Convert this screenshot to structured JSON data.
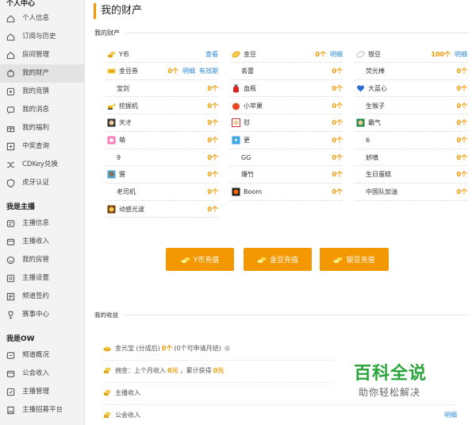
{
  "sidebar": {
    "sections": [
      {
        "title": "个人中心",
        "items": [
          {
            "label": "个人信息",
            "icon": "home-icon"
          },
          {
            "label": "订阅与历史",
            "icon": "home-icon"
          },
          {
            "label": "房间管理",
            "icon": "home-icon"
          },
          {
            "label": "我的财产",
            "icon": "wallet-icon",
            "active": true
          },
          {
            "label": "我的竞猜",
            "icon": "quiz-icon"
          },
          {
            "label": "我的消息",
            "icon": "message-icon"
          },
          {
            "label": "我的福利",
            "icon": "gift-icon"
          },
          {
            "label": "中奖查询",
            "icon": "prize-search-icon"
          },
          {
            "label": "CDKey兑换",
            "icon": "shuffle-icon"
          },
          {
            "label": "虎牙认证",
            "icon": "shield-icon"
          }
        ]
      },
      {
        "title": "我是主播",
        "items": [
          {
            "label": "主播信息",
            "icon": "anchor-info-icon"
          },
          {
            "label": "主播收入",
            "icon": "income-icon"
          },
          {
            "label": "我的房管",
            "icon": "room-admin-icon"
          },
          {
            "label": "主播设置",
            "icon": "settings-icon"
          },
          {
            "label": "频道签约",
            "icon": "contract-icon"
          },
          {
            "label": "赛事中心",
            "icon": "trophy-icon"
          }
        ]
      },
      {
        "title": "我是OW",
        "items": [
          {
            "label": "频道概况",
            "icon": "channel-icon"
          },
          {
            "label": "公会收入",
            "icon": "income-icon"
          },
          {
            "label": "主播管理",
            "icon": "manage-icon"
          },
          {
            "label": "主播招募平台",
            "icon": "recruit-icon"
          }
        ]
      }
    ]
  },
  "main": {
    "title": "我的财产",
    "subtitle": "我的财产",
    "assets_col1": [
      {
        "name": "Y币",
        "icon": "ycoin-icon",
        "link": "查看"
      },
      {
        "name": "金豆券",
        "icon": "coupon-icon",
        "count": "0个",
        "link": "明细",
        "link2": "有效期"
      },
      {
        "name": "宝剑",
        "count": "0个"
      },
      {
        "name": "挖掘机",
        "icon": "excavator-icon",
        "count": "0个"
      },
      {
        "name": "天才",
        "icon": "genius-icon",
        "count": "0个"
      },
      {
        "name": "萌",
        "icon": "cute-icon",
        "count": "0个"
      },
      {
        "name": "9",
        "count": "0个"
      },
      {
        "name": "猩",
        "icon": "gorilla-icon",
        "count": "0个"
      },
      {
        "name": "老司机",
        "count": "0个"
      },
      {
        "name": "动感光波",
        "icon": "wave-icon",
        "count": "0个"
      }
    ],
    "assets_col2": [
      {
        "name": "金豆",
        "icon": "gold-bean-icon",
        "count": "0个",
        "link": "明细"
      },
      {
        "name": "丢雷",
        "count": "0个"
      },
      {
        "name": "血瓶",
        "icon": "blood-bottle-icon",
        "count": "0个"
      },
      {
        "name": "小苹果",
        "icon": "apple-icon",
        "count": "0个"
      },
      {
        "name": "怼",
        "icon": "dui-icon",
        "count": "0个"
      },
      {
        "name": "更",
        "icon": "geng-icon",
        "count": "0个"
      },
      {
        "name": "GG",
        "count": "0个"
      },
      {
        "name": "爆竹",
        "count": "0个"
      },
      {
        "name": "Boom",
        "icon": "boom-icon",
        "count": "0个"
      }
    ],
    "assets_col3": [
      {
        "name": "银豆",
        "icon": "silver-bean-icon",
        "count": "100个",
        "link": "明细"
      },
      {
        "name": "荧光棒",
        "count": "0个"
      },
      {
        "name": "大蓝心",
        "icon": "blue-heart-icon",
        "count": "0个"
      },
      {
        "name": "生猴子",
        "count": "0个"
      },
      {
        "name": "霸气",
        "icon": "domineering-icon",
        "count": "0个"
      },
      {
        "name": "6",
        "count": "0个"
      },
      {
        "name": "娇嗔",
        "count": "0个"
      },
      {
        "name": "生日蛋糕",
        "count": "0个"
      },
      {
        "name": "中国队加油",
        "count": "0个"
      }
    ],
    "buttons": {
      "ycoin": "Y币充值",
      "gold": "金豆充值",
      "silver": "银豆充值"
    },
    "earnings_title": "我的收益",
    "earnings": {
      "row1": {
        "label": "金元宝 (分成后)",
        "value": "0个",
        "note": "(0个可申请月结)"
      },
      "row2": {
        "label": "佣金：上个月收入",
        "value": "0元",
        "sep": "，累计获得",
        "value2": "0元"
      },
      "row3": {
        "label": "主播收入"
      },
      "row4": {
        "label": "公会收入",
        "link": "明细"
      }
    }
  },
  "watermark": {
    "title": "百科全说",
    "subtitle": "助你轻松解决"
  },
  "colors": {
    "accent": "#f39800",
    "link": "#2b87d6",
    "watermark": "#2aa43b"
  }
}
